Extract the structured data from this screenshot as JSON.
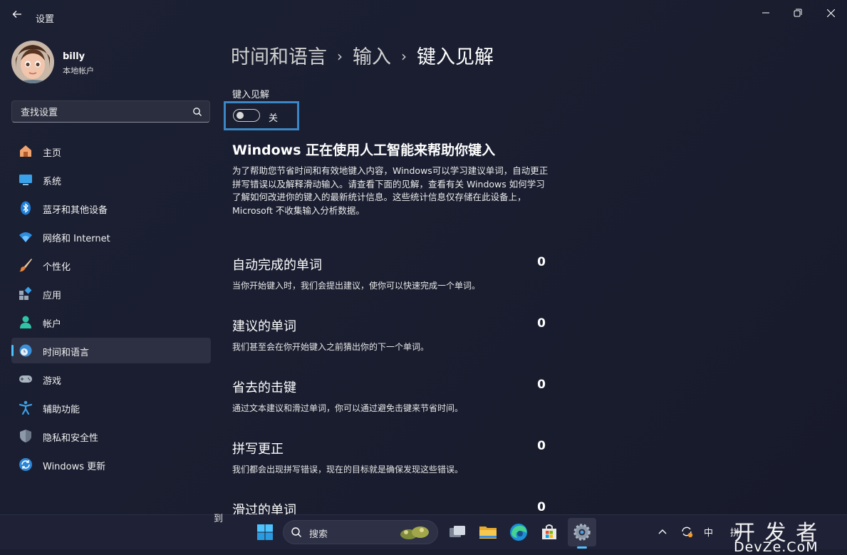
{
  "window": {
    "title": "设置",
    "back_icon": "back-arrow-icon",
    "controls": [
      "minimize-icon",
      "maximize-icon",
      "close-icon"
    ]
  },
  "profile": {
    "name": "billy",
    "account_type": "本地帐户"
  },
  "search": {
    "placeholder": "查找设置"
  },
  "sidebar": {
    "items": [
      {
        "label": "主页",
        "icon": "home-icon",
        "active": false
      },
      {
        "label": "系统",
        "icon": "system-icon",
        "active": false
      },
      {
        "label": "蓝牙和其他设备",
        "icon": "bluetooth-icon",
        "active": false
      },
      {
        "label": "网络和 Internet",
        "icon": "wifi-icon",
        "active": false
      },
      {
        "label": "个性化",
        "icon": "brush-icon",
        "active": false
      },
      {
        "label": "应用",
        "icon": "apps-icon",
        "active": false
      },
      {
        "label": "帐户",
        "icon": "account-icon",
        "active": false
      },
      {
        "label": "时间和语言",
        "icon": "time-language-icon",
        "active": true
      },
      {
        "label": "游戏",
        "icon": "gamepad-icon",
        "active": false
      },
      {
        "label": "辅助功能",
        "icon": "accessibility-icon",
        "active": false
      },
      {
        "label": "隐私和安全性",
        "icon": "shield-icon",
        "active": false
      },
      {
        "label": "Windows 更新",
        "icon": "update-icon",
        "active": false
      }
    ]
  },
  "breadcrumb": {
    "level1": "时间和语言",
    "level2": "输入",
    "current": "键入见解",
    "separator": "›"
  },
  "typing_insights": {
    "label": "键入见解",
    "toggle_state": "关",
    "toggle_on": false
  },
  "info": {
    "title": "Windows 正在使用人工智能来帮助你键入",
    "body": "为了帮助您节省时间和有效地键入内容，Windows可以学习建议单词，自动更正拼写错误以及解释滑动输入。请查看下面的见解，查看有关 Windows 如何学习了解如何改进你的键入的最新统计信息。这些统计信息仅存储在此设备上，Microsoft 不收集输入分析数据。"
  },
  "stats": [
    {
      "title": "自动完成的单词",
      "value": "0",
      "desc": "当你开始键入时，我们会提出建议，使你可以快速完成一个单词。"
    },
    {
      "title": "建议的单词",
      "value": "0",
      "desc": "我们甚至会在你开始键入之前猜出你的下一个单词。"
    },
    {
      "title": "省去的击键",
      "value": "0",
      "desc": "通过文本建议和滑过单词，你可以通过避免击键来节省时间。"
    },
    {
      "title": "拼写更正",
      "value": "0",
      "desc": "我们都会出现拼写错误，现在的目标就是确保发现这些错误。"
    },
    {
      "title": "滑过的单词",
      "value": "0",
      "desc": ""
    }
  ],
  "taskbar": {
    "peek_text": "到",
    "search_label": "搜索",
    "tray_ime": "中",
    "tray_partial": "拼",
    "watermark_main": "开 发 者",
    "watermark_sub": "DevZe.CoM",
    "accent": "#4cc2ff"
  }
}
